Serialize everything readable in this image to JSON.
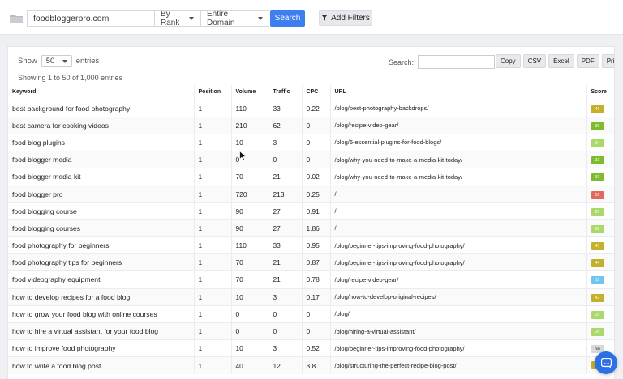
{
  "toolbar": {
    "domain_value": "foodbloggerpro.com",
    "rank_select": "By Rank",
    "scope_select": "Entire Domain",
    "search_label": "Search",
    "filters_label": "Add Filters"
  },
  "table_controls": {
    "show_label": "Show",
    "page_length": "50",
    "entries_label": "entries",
    "info": "Showing 1 to 50 of 1,000 entries",
    "search_label": "Search:",
    "exports": [
      "Copy",
      "CSV",
      "Excel",
      "PDF",
      "Print"
    ]
  },
  "columns": [
    "Keyword",
    "Position",
    "Volume",
    "Traffic",
    "CPC",
    "URL",
    "Score"
  ],
  "rows": [
    {
      "keyword": "best background for food photography",
      "position": "1",
      "volume": "110",
      "traffic": "33",
      "cpc": "0.22",
      "url": "/blog/best-photography-backdrops/",
      "score": "40",
      "score_color": "#c4b02a"
    },
    {
      "keyword": "best camera for cooking videos",
      "position": "1",
      "volume": "210",
      "traffic": "62",
      "cpc": "0",
      "url": "/blog/recipe-video-gear/",
      "score": "30",
      "score_color": "#7cbc2e"
    },
    {
      "keyword": "food blog plugins",
      "position": "1",
      "volume": "10",
      "traffic": "3",
      "cpc": "0",
      "url": "/blog/6-essential-plugins-for-food-blogs/",
      "score": "24",
      "score_color": "#a9d96a"
    },
    {
      "keyword": "food blogger media",
      "position": "1",
      "volume": "0",
      "traffic": "0",
      "cpc": "0",
      "url": "/blog/why-you-need-to-make-a-media-kit-today/",
      "score": "31",
      "score_color": "#7cbc2e"
    },
    {
      "keyword": "food blogger media kit",
      "position": "1",
      "volume": "70",
      "traffic": "21",
      "cpc": "0.02",
      "url": "/blog/why-you-need-to-make-a-media-kit-today/",
      "score": "31",
      "score_color": "#7cbc2e"
    },
    {
      "keyword": "food blogger pro",
      "position": "1",
      "volume": "720",
      "traffic": "213",
      "cpc": "0.25",
      "url": "/",
      "score": "51",
      "score_color": "#e06a5e"
    },
    {
      "keyword": "food blogging course",
      "position": "1",
      "volume": "90",
      "traffic": "27",
      "cpc": "0.91",
      "url": "/",
      "score": "25",
      "score_color": "#a9d96a"
    },
    {
      "keyword": "food blogging courses",
      "position": "1",
      "volume": "90",
      "traffic": "27",
      "cpc": "1.86",
      "url": "/",
      "score": "28",
      "score_color": "#a9d96a"
    },
    {
      "keyword": "food photography for beginners",
      "position": "1",
      "volume": "110",
      "traffic": "33",
      "cpc": "0.95",
      "url": "/blog/beginner-tips-improving-food-photography/",
      "score": "43",
      "score_color": "#c4b02a"
    },
    {
      "keyword": "food photography tips for beginners",
      "position": "1",
      "volume": "70",
      "traffic": "21",
      "cpc": "0.87",
      "url": "/blog/beginner-tips-improving-food-photography/",
      "score": "44",
      "score_color": "#c4b02a"
    },
    {
      "keyword": "food videography equipment",
      "position": "1",
      "volume": "70",
      "traffic": "21",
      "cpc": "0.78",
      "url": "/blog/recipe-video-gear/",
      "score": "19",
      "score_color": "#6ec6f0"
    },
    {
      "keyword": "how to develop recipes for a food blog",
      "position": "1",
      "volume": "10",
      "traffic": "3",
      "cpc": "0.17",
      "url": "/blog/how-to-develop-original-recipes/",
      "score": "42",
      "score_color": "#c4b02a"
    },
    {
      "keyword": "how to grow your food blog with online courses",
      "position": "1",
      "volume": "0",
      "traffic": "0",
      "cpc": "0",
      "url": "/blog/",
      "score": "25",
      "score_color": "#a9d96a"
    },
    {
      "keyword": "how to hire a virtual assistant for your food blog",
      "position": "1",
      "volume": "0",
      "traffic": "0",
      "cpc": "0",
      "url": "/blog/hiring-a-virtual-assistant/",
      "score": "26",
      "score_color": "#a9d96a"
    },
    {
      "keyword": "how to improve food photography",
      "position": "1",
      "volume": "10",
      "traffic": "3",
      "cpc": "0.52",
      "url": "/blog/beginner-tips-improving-food-photography/",
      "score": "NA",
      "score_color": "#d8d8d8"
    },
    {
      "keyword": "how to write a food blog post",
      "position": "1",
      "volume": "40",
      "traffic": "12",
      "cpc": "3.8",
      "url": "/blog/structuring-the-perfect-recipe-blog-post/",
      "score": "",
      "score_color": "#c4b02a"
    }
  ]
}
